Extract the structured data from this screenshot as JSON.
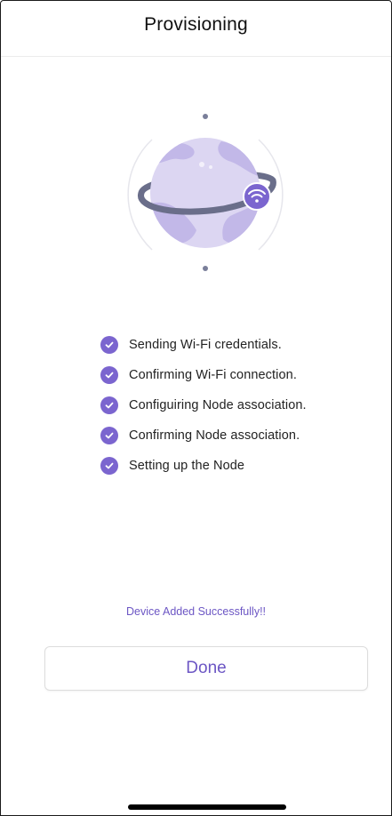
{
  "header": {
    "title": "Provisioning"
  },
  "illustration": {
    "icon": "globe-wifi-icon",
    "badge_icon": "wifi-icon"
  },
  "steps": [
    {
      "label": "Sending Wi-Fi credentials.",
      "done": true
    },
    {
      "label": "Confirming Wi-Fi connection.",
      "done": true
    },
    {
      "label": "Configuiring Node association.",
      "done": true
    },
    {
      "label": "Confirming Node association.",
      "done": true
    },
    {
      "label": "Setting up the Node",
      "done": true
    }
  ],
  "status": {
    "message": "Device Added Successfully!!"
  },
  "actions": {
    "done_label": "Done"
  },
  "colors": {
    "accent": "#7b65cf",
    "accent_text": "#6c56c4",
    "globe": "#dcd6f2",
    "globe_land": "#c2b8e8",
    "ring": "#6a6e8a"
  }
}
